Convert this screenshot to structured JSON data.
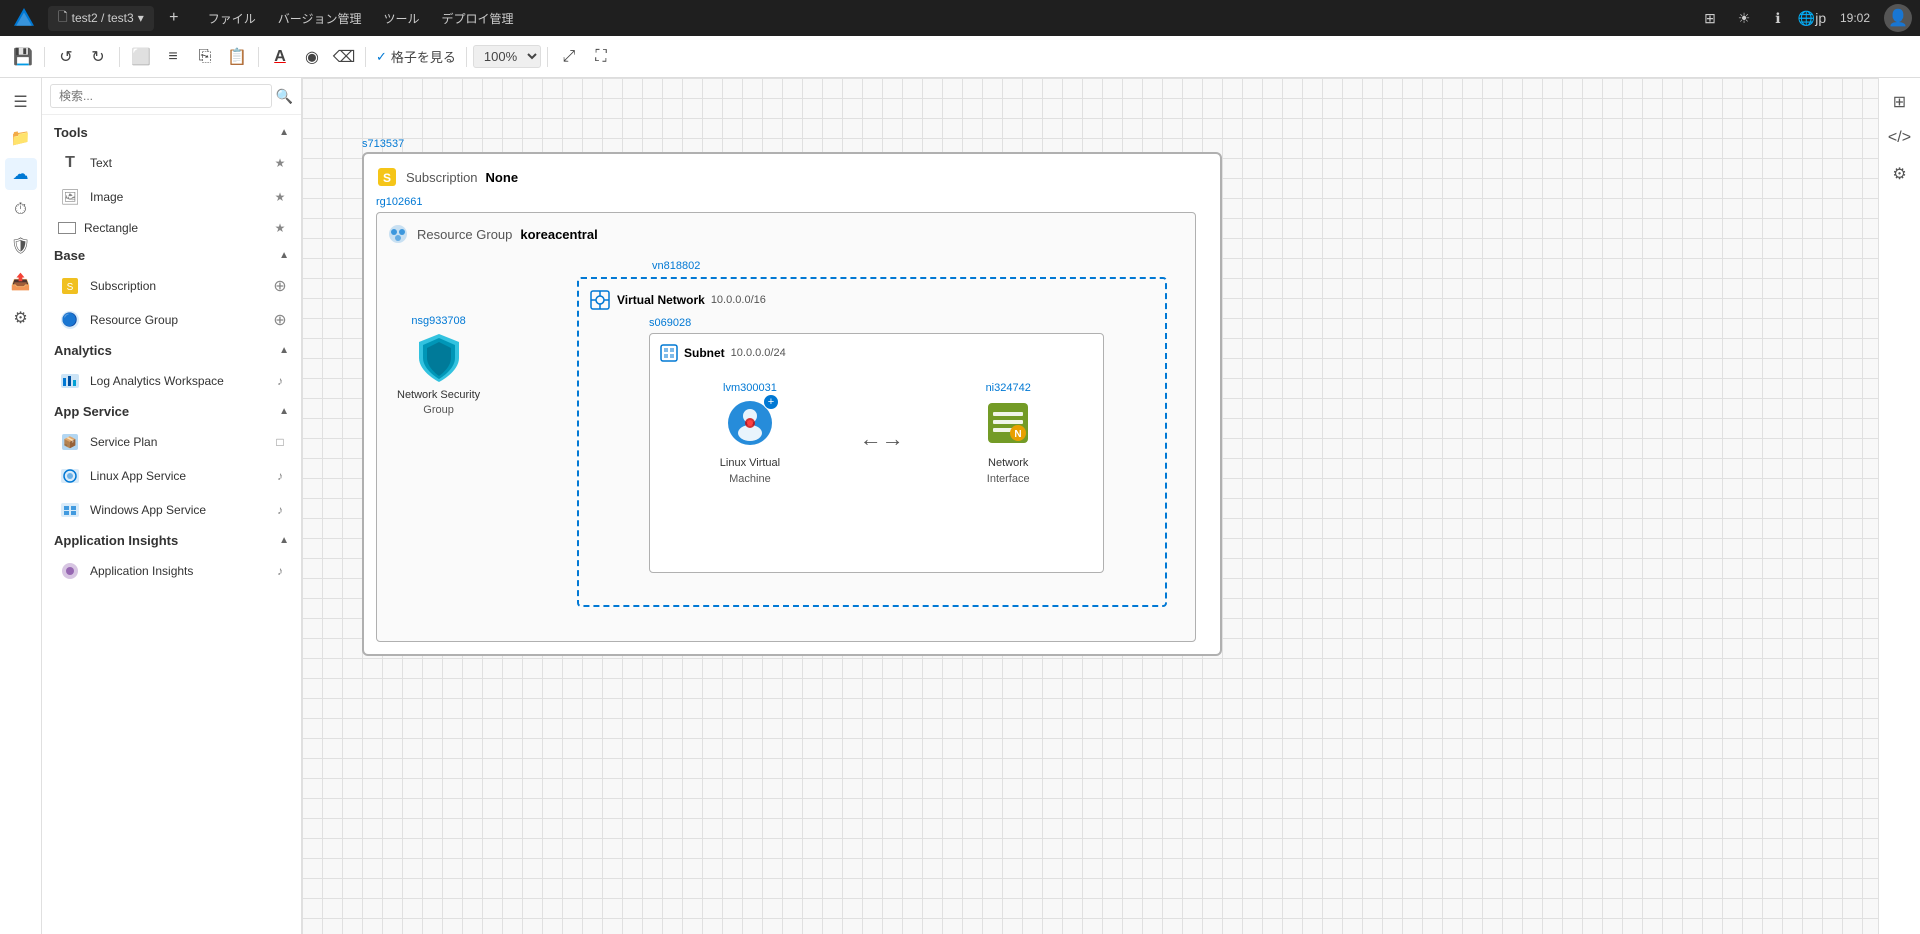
{
  "menubar": {
    "app_icon": "A",
    "breadcrumb": "test2 / test3",
    "breadcrumb_chevron": "▾",
    "new_tab": "+",
    "menus": [
      "ファイル",
      "バージョン管理",
      "ツール",
      "デプロイ管理"
    ],
    "right": {
      "grid_icon": "⊞",
      "sun_icon": "☀",
      "info_icon": "ℹ",
      "lang": "jp",
      "time": "19:02"
    }
  },
  "toolbar": {
    "undo": "↺",
    "redo": "↻",
    "frame": "⬜",
    "list": "≡",
    "copy": "⎘",
    "paste": "📋",
    "text_color": "A",
    "fill": "◉",
    "eraser": "⌫",
    "grid_label": "格子を見る",
    "zoom": "100%",
    "fit": "⤢",
    "present": "▶"
  },
  "sidebar": {
    "search_placeholder": "検索...",
    "sections": [
      {
        "id": "tools",
        "label": "Tools",
        "items": [
          {
            "id": "text",
            "label": "Text",
            "icon": "T",
            "action": "★"
          },
          {
            "id": "image",
            "label": "Image",
            "icon": "🖼",
            "action": "★"
          },
          {
            "id": "rectangle",
            "label": "Rectangle",
            "icon": "▭",
            "action": "★"
          }
        ]
      },
      {
        "id": "base",
        "label": "Base",
        "items": [
          {
            "id": "subscription",
            "label": "Subscription",
            "icon": "🔑",
            "action": "⊕"
          },
          {
            "id": "resource-group",
            "label": "Resource Group",
            "icon": "🔵",
            "action": "⊕"
          }
        ]
      },
      {
        "id": "analytics",
        "label": "Analytics",
        "items": [
          {
            "id": "log-analytics",
            "label": "Log Analytics Workspace",
            "icon": "📊",
            "action": "♪"
          }
        ]
      },
      {
        "id": "app-service",
        "label": "App Service",
        "items": [
          {
            "id": "service-plan",
            "label": "Service Plan",
            "icon": "📦",
            "action": "□"
          },
          {
            "id": "linux-app",
            "label": "Linux App Service",
            "icon": "🔷",
            "action": "♪"
          },
          {
            "id": "windows-app",
            "label": "Windows App Service",
            "icon": "🔷",
            "action": "♪"
          }
        ]
      },
      {
        "id": "application-insights",
        "label": "Application Insights",
        "items": [
          {
            "id": "app-insights",
            "label": "Application Insights",
            "icon": "💜",
            "action": "♪"
          }
        ]
      }
    ]
  },
  "left_icons": [
    "☰",
    "📁",
    "☁",
    "⏱",
    "🔒",
    "📤",
    "⚙"
  ],
  "canvas": {
    "s713537": "s713537",
    "subscription": {
      "title": "Subscription",
      "name": "None"
    },
    "rg102661": "rg102661",
    "resource_group": {
      "title": "Resource Group",
      "location": "koreacentral"
    },
    "vn818802": "vn818802",
    "virtual_network": {
      "title": "Virtual Network",
      "cidr": "10.0.0.0/16"
    },
    "s069028": "s069028",
    "subnet": {
      "title": "Subnet",
      "cidr": "10.0.0.0/24"
    },
    "nsg933708": "nsg933708",
    "nsg": {
      "title": "Network Security Group"
    },
    "lvm300031": "lvm300031",
    "lvm": {
      "title": "Linux Virtual Machine"
    },
    "ni324742": "ni324742",
    "ni": {
      "title": "Network Interface"
    }
  }
}
